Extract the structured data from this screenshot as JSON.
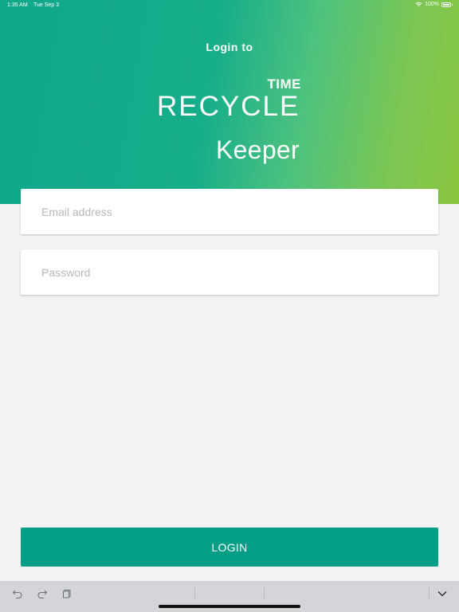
{
  "status_bar": {
    "time": "1:35 AM",
    "date": "Tue Sep 3",
    "battery": "100%"
  },
  "header": {
    "login_to": "Login to",
    "logo_top": "TIME",
    "logo_main": "RECYCLE",
    "subtitle": "Keeper"
  },
  "form": {
    "email_placeholder": "Email address",
    "email_value": "",
    "password_placeholder": "Password",
    "password_value": ""
  },
  "actions": {
    "login_label": "LOGIN"
  },
  "keyboard_bar": {
    "icons": [
      "undo-icon",
      "redo-icon",
      "paste-icon",
      "keyboard-dismiss-icon"
    ]
  },
  "colors": {
    "gradient_start": "#11a88a",
    "gradient_end": "#8ac640",
    "button": "#049e86",
    "background": "#f3f3f3"
  }
}
